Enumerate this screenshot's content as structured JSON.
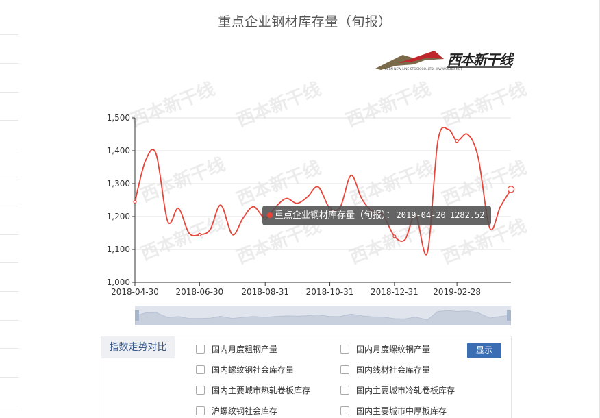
{
  "title": "重点企业钢材库存量（旬报）",
  "logo": {
    "brand_text": "西本新干线",
    "subtext": "XIBEN NEW LINE STOCK CO.,LTD.  WWW.96369.NET"
  },
  "watermark_text": "西本新干线",
  "colors": {
    "series": "#e8453a",
    "accent_button": "#3b6db3",
    "panel_header_bg": "#eef0f4"
  },
  "chart_data": {
    "type": "line",
    "title": "重点企业钢材库存量（旬报）",
    "xlabel": "",
    "ylabel": "",
    "ylim": [
      1000,
      1500
    ],
    "y_ticks": [
      "1,000",
      "1,100",
      "1,200",
      "1,300",
      "1,400",
      "1,500"
    ],
    "x_ticks": [
      "2018-04-30",
      "2018-06-30",
      "2018-08-31",
      "2018-10-31",
      "2018-12-31",
      "2019-02-28"
    ],
    "grid": true,
    "smooth": true,
    "x": [
      "2018-04-30",
      "2018-05-10",
      "2018-05-20",
      "2018-05-31",
      "2018-06-10",
      "2018-06-20",
      "2018-06-30",
      "2018-07-10",
      "2018-07-20",
      "2018-07-31",
      "2018-08-10",
      "2018-08-20",
      "2018-08-31",
      "2018-09-10",
      "2018-09-20",
      "2018-09-30",
      "2018-10-10",
      "2018-10-20",
      "2018-10-31",
      "2018-11-10",
      "2018-11-20",
      "2018-11-30",
      "2018-12-10",
      "2018-12-20",
      "2018-12-31",
      "2019-01-10",
      "2019-01-20",
      "2019-01-31",
      "2019-02-10",
      "2019-02-20",
      "2019-02-28",
      "2019-03-10",
      "2019-03-20",
      "2019-03-31",
      "2019-04-10",
      "2019-04-20"
    ],
    "series": [
      {
        "values": [
          1245,
          1370,
          1390,
          1185,
          1225,
          1150,
          1145,
          1160,
          1235,
          1145,
          1195,
          1230,
          1195,
          1230,
          1255,
          1240,
          1260,
          1290,
          1225,
          1230,
          1325,
          1255,
          1215,
          1205,
          1140,
          1130,
          1205,
          1090,
          1430,
          1465,
          1430,
          1450,
          1380,
          1165,
          1230,
          1282.52
        ]
      }
    ],
    "tooltip": {
      "series_label": "重点企业钢材库存量（旬报）：",
      "date": "2019-04-20",
      "value": "1282.52"
    }
  },
  "compare_panel": {
    "header": "指数走势对比",
    "button": "显示",
    "options": [
      "国内月度粗钢产量",
      "国内月度螺纹钢产量",
      "国内螺纹钢社会库存量",
      "国内线材社会库存量",
      "国内主要城市热轧卷板库存",
      "国内主要城市冷轧卷板库存",
      "沪螺纹钢社会库存",
      "国内主要城市中厚板库存"
    ]
  }
}
